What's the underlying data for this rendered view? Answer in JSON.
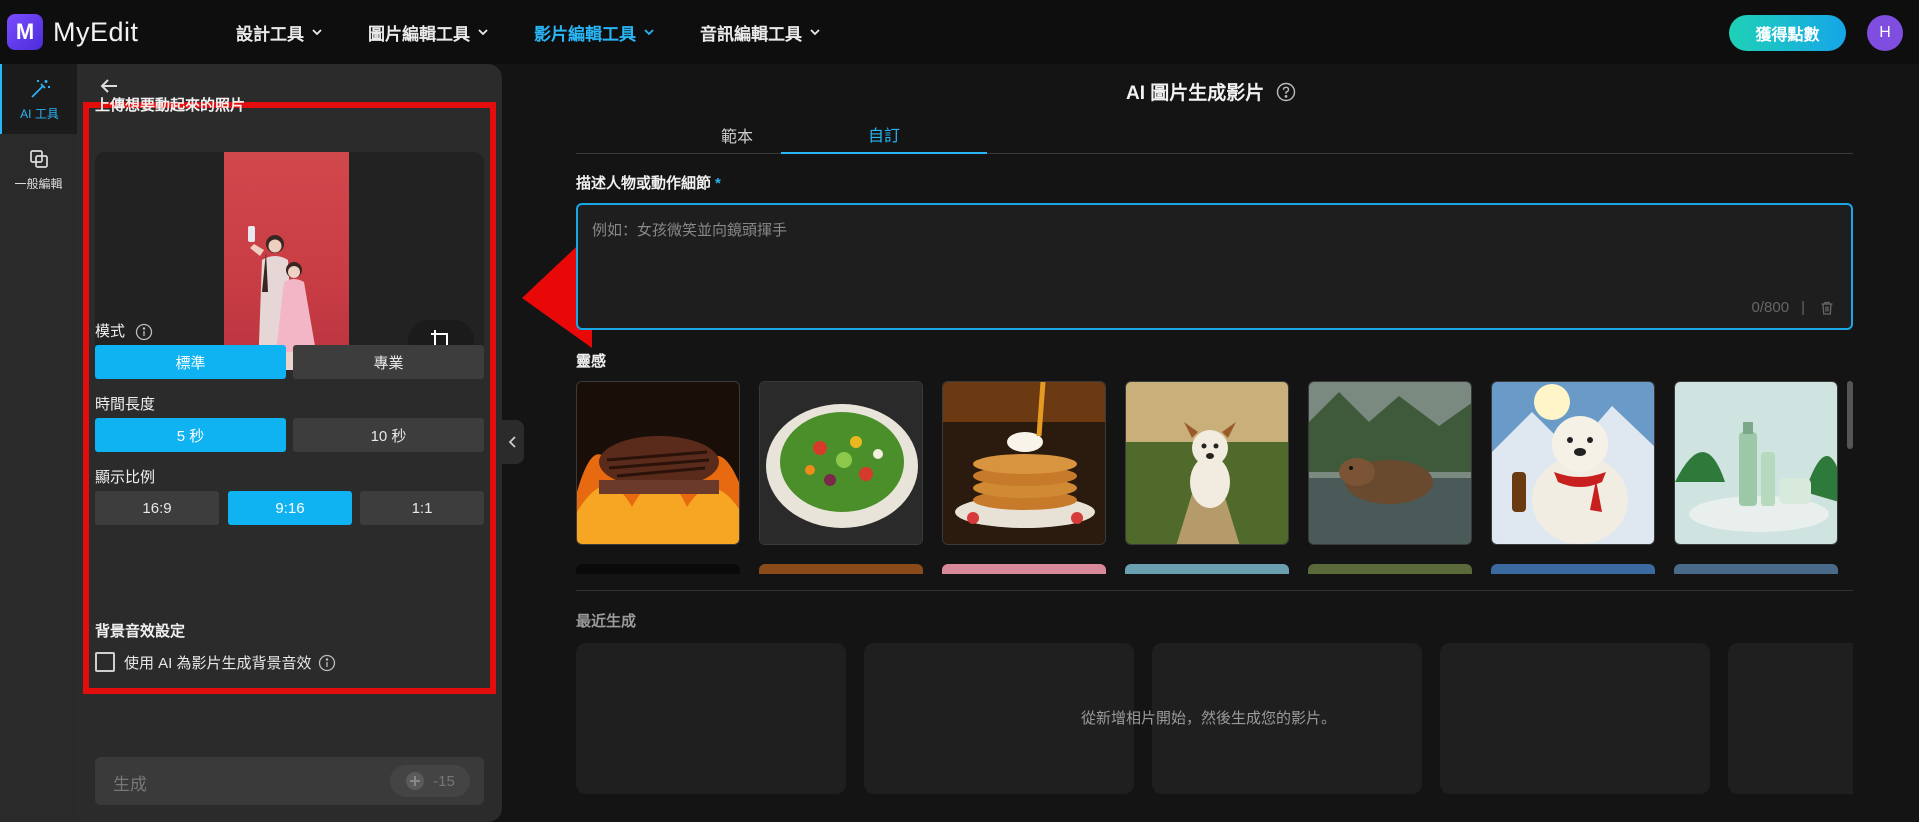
{
  "app": {
    "logo_letter": "M",
    "name": "MyEdit"
  },
  "nav": {
    "items": [
      {
        "label": "設計工具"
      },
      {
        "label": "圖片編輯工具"
      },
      {
        "label": "影片編輯工具",
        "active": true
      },
      {
        "label": "音訊編輯工具"
      }
    ],
    "points_button": "獲得點數",
    "avatar_initial": "H"
  },
  "rail": {
    "items": [
      {
        "label": "AI 工具",
        "icon": "magic-wand-icon",
        "active": true
      },
      {
        "label": "一般編輯",
        "icon": "copy-layers-icon"
      }
    ]
  },
  "panel": {
    "upload_title": "上傳想要動起來的照片",
    "mode": {
      "label": "模式",
      "options": [
        "標準",
        "專業"
      ],
      "selected": "標準"
    },
    "duration": {
      "label": "時間長度",
      "options": [
        "5 秒",
        "10 秒"
      ],
      "selected": "5 秒"
    },
    "ratio": {
      "label": "顯示比例",
      "options": [
        "16:9",
        "9:16",
        "1:1"
      ],
      "selected": "9:16"
    },
    "bg_audio": {
      "title": "背景音效設定",
      "checkbox_label": "使用 AI 為影片生成背景音效",
      "checked": false
    },
    "generate": {
      "label": "生成",
      "cost": "-15"
    }
  },
  "main": {
    "title": "AI 圖片生成影片",
    "tabs": [
      {
        "label": "範本"
      },
      {
        "label": "自訂",
        "active": true
      }
    ],
    "prompt": {
      "label": "描述人物或動作細節",
      "required_mark": "*",
      "placeholder": "例如：女孩微笑並向鏡頭揮手",
      "counter": "0/800",
      "separator": "|"
    },
    "inspiration_label": "靈感",
    "inspiration_items": [
      "grilled-steak",
      "salad-bowl",
      "pancakes-syrup",
      "running-dog",
      "capybara-hot-spring",
      "polar-bear-scarf",
      "skincare-bottles"
    ],
    "recent_label": "最近生成",
    "recent_empty": "從新增相片開始，然後生成您的影片。"
  },
  "colors": {
    "accent": "#29b6f6",
    "highlight_red": "#e40d0d",
    "points_gradient_start": "#1fd1b6",
    "points_gradient_end": "#16a5e8"
  }
}
